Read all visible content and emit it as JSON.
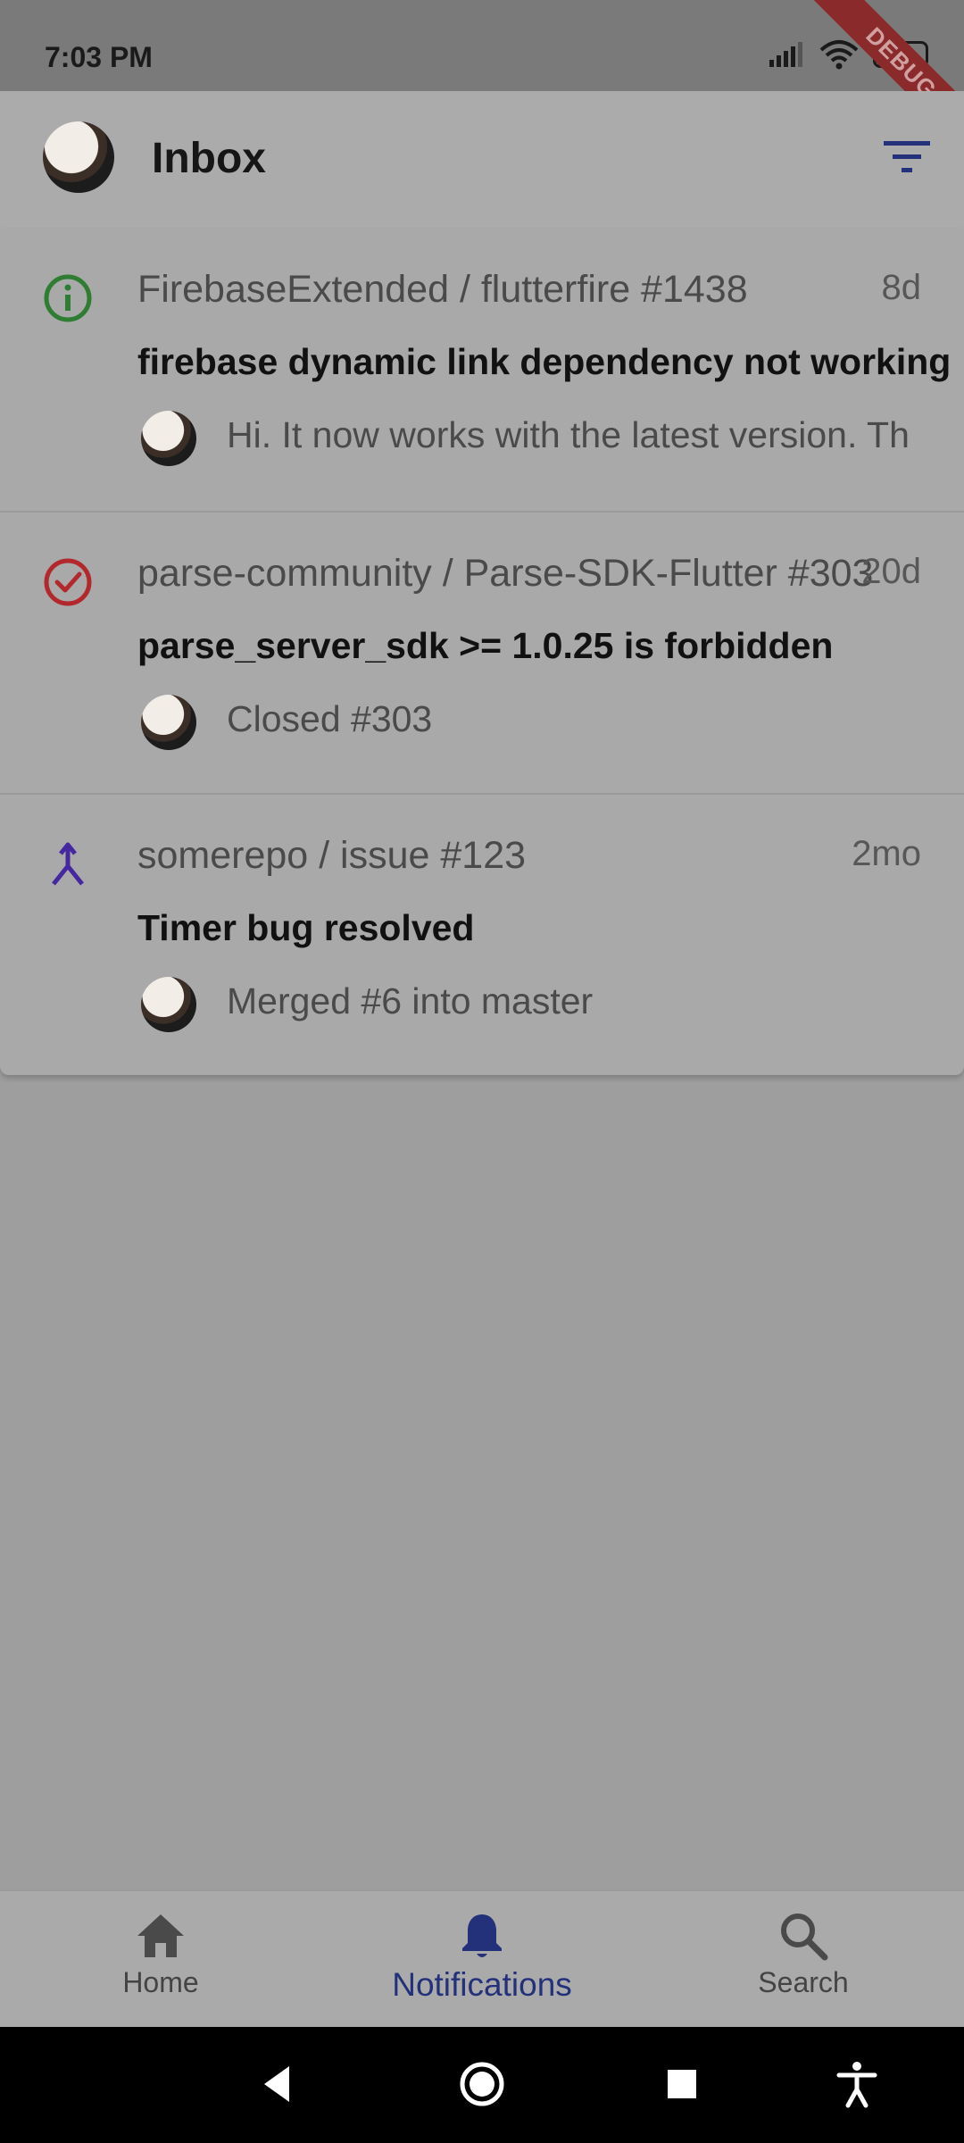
{
  "status_bar": {
    "time": "7:03 PM",
    "battery": "98"
  },
  "debug_banner": "DEBUG",
  "app_bar": {
    "title": "Inbox",
    "filter_icon": "filter-list-icon"
  },
  "notifications": [
    {
      "status_icon": "info-circle-icon",
      "status_color": "#2e7d32",
      "repo": "FirebaseExtended / flutterfire #1438",
      "time": "8d",
      "title": "firebase dynamic link dependency not working",
      "preview": "Hi. It now works with the latest version. Th"
    },
    {
      "status_icon": "check-circle-icon",
      "status_color": "#b3282d",
      "repo": "parse-community / Parse-SDK-Flutter #303",
      "time": "20d",
      "title": "parse_server_sdk >= 1.0.25 is forbidden",
      "preview": "Closed #303"
    },
    {
      "status_icon": "merge-icon",
      "status_color": "#4527a0",
      "repo": "somerepo / issue #123",
      "time": "2mo",
      "title": "Timer bug resolved",
      "preview": "Merged #6 into master"
    }
  ],
  "bottom_nav": {
    "items": [
      {
        "label": "Home",
        "icon": "home-icon",
        "active": false
      },
      {
        "label": "Notifications",
        "icon": "bell-icon",
        "active": true
      },
      {
        "label": "Search",
        "icon": "search-icon",
        "active": false
      }
    ]
  },
  "colors": {
    "accent": "#23317a",
    "scrim": "#9e9e9e"
  }
}
